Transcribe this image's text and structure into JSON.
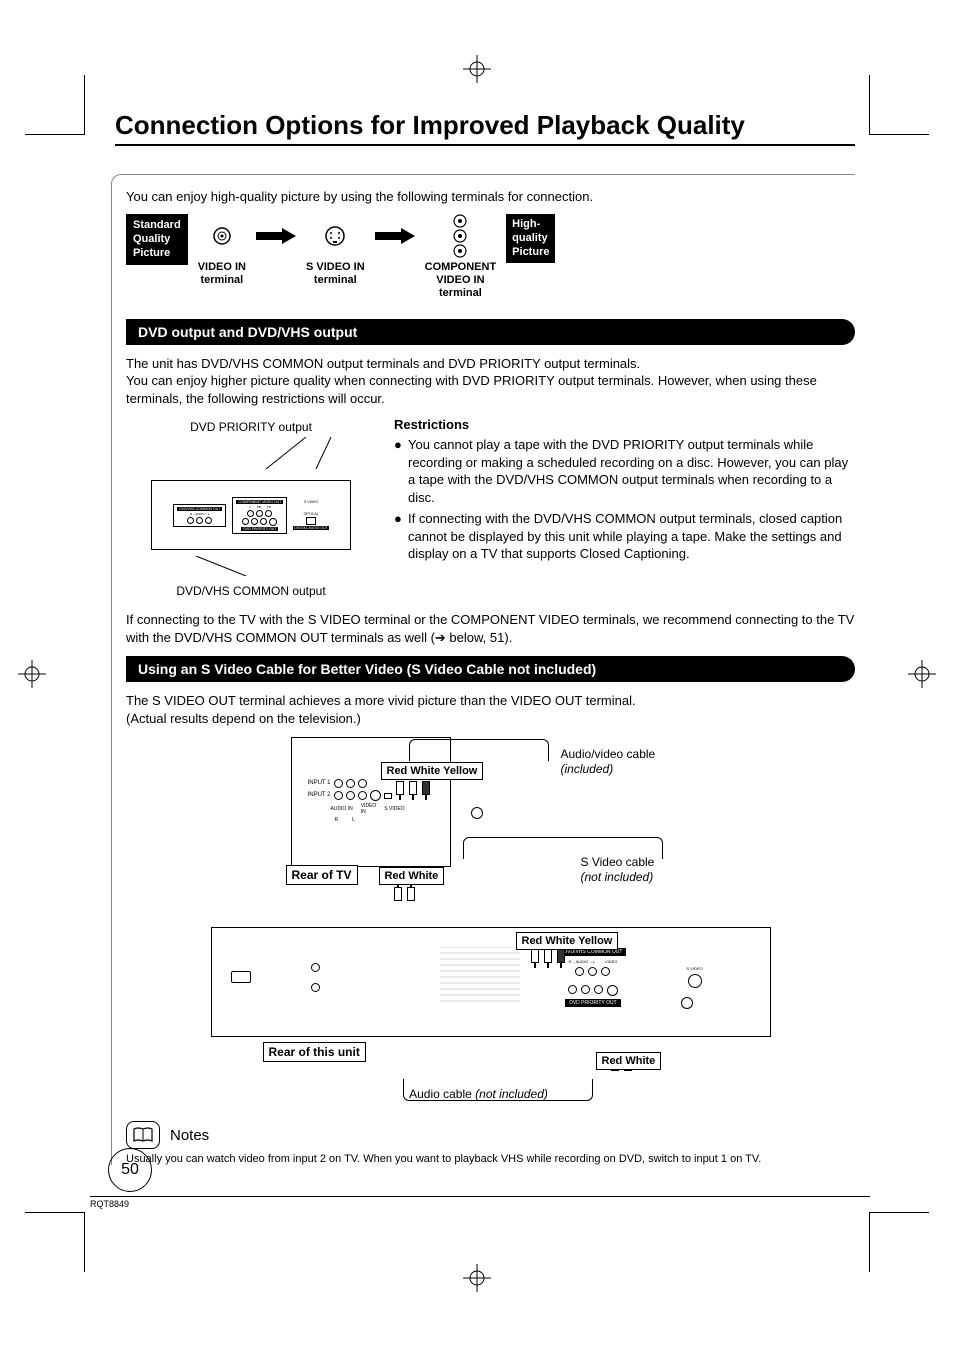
{
  "title": "Connection Options for Improved Playback Quality",
  "intro": "You can enjoy high-quality picture by using the following terminals for connection.",
  "quality": {
    "std_badge": "Standard\nQuality\nPicture",
    "hq_badge": "High-\nquality\nPicture",
    "terminals": [
      {
        "label": "VIDEO IN\nterminal"
      },
      {
        "label": "S VIDEO IN\nterminal"
      },
      {
        "label": "COMPONENT\nVIDEO IN\nterminal"
      }
    ]
  },
  "section1": {
    "bar": "DVD output and DVD/VHS output",
    "p1": "The unit has DVD/VHS COMMON output terminals and DVD PRIORITY output terminals.",
    "p2": "You can enjoy higher picture quality when connecting with DVD PRIORITY output terminals. However, when using these terminals, the following restrictions will occur.",
    "priority_label": "DVD PRIORITY output",
    "common_label": "DVD/VHS COMMON output",
    "restrictions_head": "Restrictions",
    "bullets": [
      "You cannot play a tape with the DVD PRIORITY output terminals while recording or making a scheduled recording on a disc. However, you can play a tape with the DVD/VHS COMMON output terminals when recording to a disc.",
      "If connecting with the DVD/VHS COMMON output terminals, closed caption cannot be displayed by this unit while playing a tape. Make the settings and display on a TV that supports Closed Captioning."
    ],
    "p3": "If connecting to the TV with the S VIDEO terminal or the COMPONENT VIDEO terminals, we recommend connecting to the TV with the DVD/VHS COMMON OUT terminals as well (➔ below, 51)."
  },
  "section2": {
    "bar": "Using an S Video Cable for Better Video (S Video Cable not included)",
    "p1": "The S VIDEO OUT terminal achieves a more vivid picture than the VIDEO OUT terminal.",
    "p2": "(Actual results depend on the television.)",
    "tags": {
      "red_white_yellow": "Red White Yellow",
      "red_white": "Red White",
      "rear_tv": "Rear of TV",
      "rear_unit": "Rear of this unit"
    },
    "cables": {
      "av": {
        "name": "Audio/video cable",
        "note": "(included)"
      },
      "sv": {
        "name": "S Video cable",
        "note": "(not included)"
      },
      "audio": {
        "name": "Audio cable",
        "note": "(not included)"
      }
    },
    "tv_inputs": {
      "input1": "INPUT 1",
      "input2": "INPUT 2",
      "audio_in": "AUDIO IN",
      "r": "R",
      "l": "L",
      "video_in": "VIDEO\nIN",
      "svideo": "S VIDEO"
    },
    "unit_labels": {
      "common_out": "DVD/VHS COMMON OUT",
      "priority_out": "DVD PRIORITY OUT",
      "audio": "R – AUDIO – L",
      "video": "VIDEO",
      "svideo": "S VIDEO"
    }
  },
  "mini_panel": {
    "common_out": "DVD/VHS COMMON OUT",
    "component_out": "COMPONENT VIDEO OUT",
    "audio": "R – AUDIO – L",
    "video": "VIDEO",
    "y": "Y",
    "pb": "PB",
    "pr": "PR",
    "svideo": "S VIDEO",
    "priority_out": "DVD PRIORITY OUT",
    "optical": "OPTICAL",
    "digital_audio": "DIGITAL AUDIO OUT"
  },
  "notes": {
    "title": "Notes",
    "text": "Usually you can watch video from input 2 on TV. When you want to playback VHS while recording on DVD, switch to input 1 on TV."
  },
  "page_number": "50",
  "doc_code": "RQT8849"
}
